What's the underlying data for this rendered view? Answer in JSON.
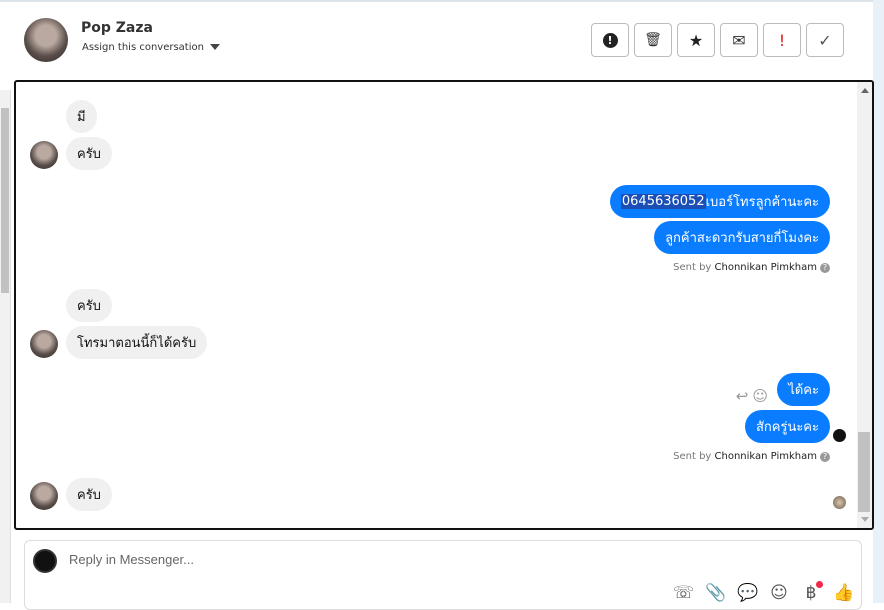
{
  "header": {
    "name": "Pop Zaza",
    "assign_label": "Assign this conversation"
  },
  "toolbar": [
    {
      "icon": "alert-circle-icon",
      "glyph": "●"
    },
    {
      "icon": "trash-icon",
      "glyph": "🗑"
    },
    {
      "icon": "star-icon",
      "glyph": "★"
    },
    {
      "icon": "mail-open-icon",
      "glyph": "✉"
    },
    {
      "icon": "important-icon",
      "glyph": "!"
    },
    {
      "icon": "check-icon",
      "glyph": "✓"
    }
  ],
  "messages": [
    {
      "dir": "in",
      "text": "มี"
    },
    {
      "dir": "in",
      "text": "ครับ"
    },
    {
      "dir": "out",
      "highlight": "0645636052",
      "text": " เบอร์โทรลูกค้านะคะ"
    },
    {
      "dir": "out",
      "text": "ลูกค้าสะดวกรับสายกี่โมงคะ"
    },
    {
      "dir": "in",
      "text": "ครับ"
    },
    {
      "dir": "in",
      "text": "โทรมาตอนนี้ก็ได้ครับ"
    },
    {
      "dir": "out",
      "text": "ได้คะ"
    },
    {
      "dir": "out",
      "text": "สักครู่นะคะ"
    },
    {
      "dir": "in",
      "text": "ครับ"
    }
  ],
  "sent_by": {
    "prefix": "Sent by",
    "agent": "Chonnikan Pimkham"
  },
  "composer": {
    "placeholder": "Reply in Messenger..."
  },
  "colors": {
    "outgoing": "#0a7cff",
    "incoming": "#f0f0f0",
    "badge": "#f0284a"
  }
}
